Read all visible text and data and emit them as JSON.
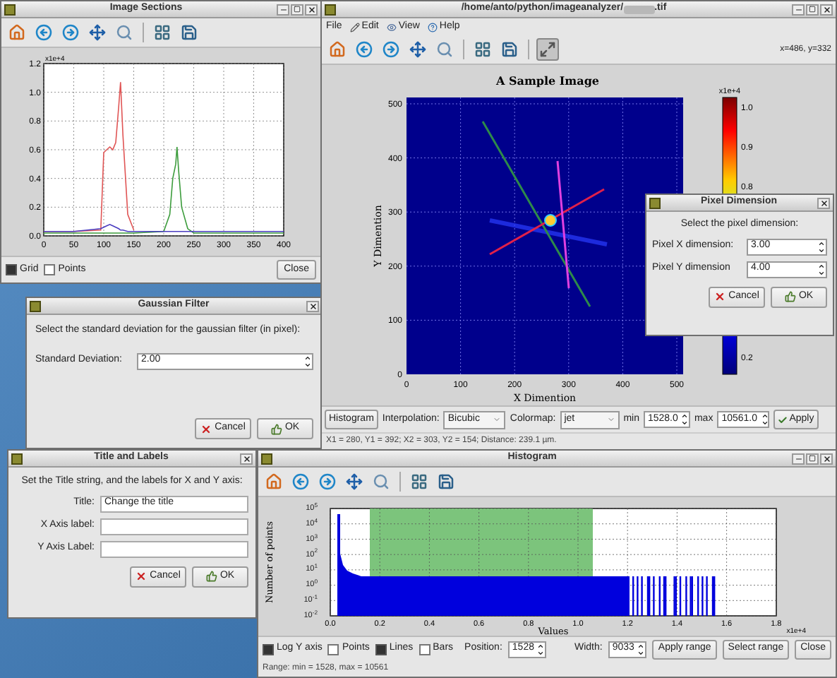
{
  "image_sections": {
    "title": "Image Sections",
    "toolbar": [
      {
        "kind": "home",
        "selected": false
      },
      {
        "kind": "back",
        "selected": false
      },
      {
        "kind": "forward",
        "selected": false
      },
      {
        "kind": "pan",
        "selected": false
      },
      {
        "kind": "zoom",
        "selected": false
      },
      {
        "kind": "subplots",
        "selected": false
      },
      {
        "kind": "save",
        "selected": false
      }
    ],
    "exponent": "x1e+4",
    "chart_data": {
      "type": "line",
      "x": [
        0,
        50,
        95,
        100,
        105,
        110,
        115,
        120,
        125,
        128,
        132,
        140,
        150,
        200,
        210,
        215,
        220,
        222,
        225,
        230,
        240,
        250,
        300,
        350,
        400
      ],
      "xlim": [
        0,
        400
      ],
      "ylim": [
        0,
        1.2
      ],
      "xticks": [
        0,
        50,
        100,
        150,
        200,
        250,
        300,
        350,
        400
      ],
      "yticks": [
        {
          "value": 0,
          "label": "0.0"
        },
        {
          "value": 0.2,
          "label": "0.2"
        },
        {
          "value": 0.4,
          "label": "0.4"
        },
        {
          "value": 0.6,
          "label": "0.6"
        },
        {
          "value": 0.8,
          "label": "0.8"
        },
        {
          "value": 1.0,
          "label": "1.0"
        },
        {
          "value": 1.2,
          "label": "1.2"
        }
      ],
      "grid": true,
      "series": [
        {
          "color": "#e05555",
          "values": [
            0.03,
            0.03,
            0.04,
            0.58,
            0.6,
            0.62,
            0.6,
            0.65,
            0.9,
            1.07,
            0.7,
            0.15,
            0.04,
            null,
            null,
            null,
            null,
            null,
            null,
            null,
            null,
            null,
            null,
            null,
            null
          ]
        },
        {
          "color": "#3c9c3c",
          "values": [
            0.02,
            0.02,
            0.02,
            0.02,
            0.02,
            0.02,
            0.02,
            0.02,
            0.02,
            0.02,
            0.02,
            0.02,
            0.02,
            0.03,
            0.15,
            0.4,
            0.5,
            0.62,
            0.45,
            0.2,
            0.05,
            0.02,
            0.02,
            0.02,
            0.02
          ]
        },
        {
          "color": "#4a3cc0",
          "values": [
            0.03,
            0.03,
            0.05,
            0.06,
            0.07,
            0.08,
            0.07,
            0.06,
            0.05,
            0.04,
            0.04,
            0.03,
            0.03,
            0.03,
            0.03,
            0.03,
            0.03,
            0.03,
            0.03,
            0.03,
            0.03,
            0.03,
            0.03,
            0.03,
            0.03
          ]
        }
      ]
    },
    "options": [
      {
        "label": "Grid",
        "checked": true
      },
      {
        "label": "Points",
        "checked": false
      }
    ],
    "close_button": "Close"
  },
  "main_window": {
    "title": "/home/anto/python/imageanalyzer/",
    "title_suffix": ".tif",
    "menu": [
      {
        "label": "File",
        "kind": "plain"
      },
      {
        "label": "Edit",
        "kind": "edit"
      },
      {
        "label": "View",
        "kind": "view"
      },
      {
        "label": "Help",
        "kind": "help"
      }
    ],
    "toolbar": [
      {
        "kind": "home",
        "selected": false
      },
      {
        "kind": "back",
        "selected": false
      },
      {
        "kind": "forward",
        "selected": false
      },
      {
        "kind": "pan",
        "selected": false
      },
      {
        "kind": "zoom",
        "selected": false
      },
      {
        "kind": "subplots",
        "selected": false
      },
      {
        "kind": "save",
        "selected": false
      },
      {
        "kind": "expand",
        "selected": true
      }
    ],
    "coordinates": "x=486, y=332",
    "image": {
      "title": "A Sample Image",
      "xlabel": "X Dimention",
      "ylabel": "Y Dimention",
      "xticks": [
        "0",
        "100",
        "200",
        "300",
        "400",
        "500"
      ],
      "yticks": [
        "500",
        "400",
        "300",
        "200",
        "100",
        "0"
      ],
      "colorbar_exponent": "x1e+4",
      "colorbar_ticks": [
        "1.0",
        "0.9",
        "0.8",
        "0.2"
      ]
    },
    "histogram_button": "Histogram",
    "interpolation": {
      "label": "Interpolation:",
      "value": "Bicubic"
    },
    "colormap": {
      "label": "Colormap:",
      "value": "jet"
    },
    "min": {
      "label": "min",
      "value": "1528.0"
    },
    "max": {
      "label": "max",
      "value": "10561.0"
    },
    "apply_button": "Apply",
    "status": "X1 = 280, Y1 = 392; X2 = 303, Y2 = 154; Distance: 239.1 µm."
  },
  "pixel_dialog": {
    "title": "Pixel Dimension",
    "prompt": "Select the pixel dimension:",
    "fields": [
      {
        "label": "Pixel X dimension:",
        "value": "3.00"
      },
      {
        "label": "Pixel Y dimension",
        "value": "4.00"
      }
    ],
    "buttons": [
      {
        "kind": "cancel",
        "label": "Cancel"
      },
      {
        "kind": "ok",
        "label": "OK"
      }
    ]
  },
  "gaussian_dialog": {
    "title": "Gaussian Filter",
    "prompt": "Select the standard deviation for the gaussian filter (in pixel):",
    "field": {
      "label": "Standard Deviation:",
      "value": "2.00"
    },
    "buttons": [
      {
        "kind": "cancel",
        "label": "Cancel"
      },
      {
        "kind": "ok",
        "label": "OK"
      }
    ]
  },
  "title_dialog": {
    "title": "Title and Labels",
    "prompt": "Set the Title string, and the labels for X and Y axis:",
    "fields": [
      {
        "label": "Title:",
        "value": "Change the title"
      },
      {
        "label": "X Axis label:"
      },
      {
        "label": "Y Axis Label:"
      }
    ],
    "buttons": [
      {
        "kind": "cancel",
        "label": "Cancel"
      },
      {
        "kind": "ok",
        "label": "OK"
      }
    ]
  },
  "histogram": {
    "title": "Histogram",
    "toolbar": [
      {
        "kind": "home",
        "selected": false
      },
      {
        "kind": "back",
        "selected": false
      },
      {
        "kind": "forward",
        "selected": false
      },
      {
        "kind": "pan",
        "selected": false
      },
      {
        "kind": "zoom",
        "selected": false
      },
      {
        "kind": "subplots",
        "selected": false
      },
      {
        "kind": "save",
        "selected": false
      }
    ],
    "ylabel": "Number of points",
    "xlabel": "Values",
    "exponent": "x1e+4",
    "yticks": [
      "10$^{5}$",
      "10$^{4}$",
      "10$^{3}$",
      "10$^{2}$",
      "10$^{1}$",
      "10$^{0}$",
      "10$^{-1}$",
      "10$^{-2}$"
    ],
    "xticks": [
      "0.0",
      "0.2",
      "0.4",
      "0.6",
      "0.8",
      "1.0",
      "1.2",
      "1.4",
      "1.6",
      "1.8"
    ],
    "options": [
      {
        "label": "Log Y axis",
        "checked": true
      },
      {
        "label": "Points",
        "checked": false
      },
      {
        "label": "Lines",
        "checked": true
      },
      {
        "label": "Bars",
        "checked": false
      }
    ],
    "position": {
      "label": "Position:",
      "value": "1528"
    },
    "width": {
      "label": "Width:",
      "value": "9033"
    },
    "buttons": [
      "Apply range",
      "Select range",
      "Close"
    ],
    "status": "Range: min = 1528, max = 10561"
  }
}
